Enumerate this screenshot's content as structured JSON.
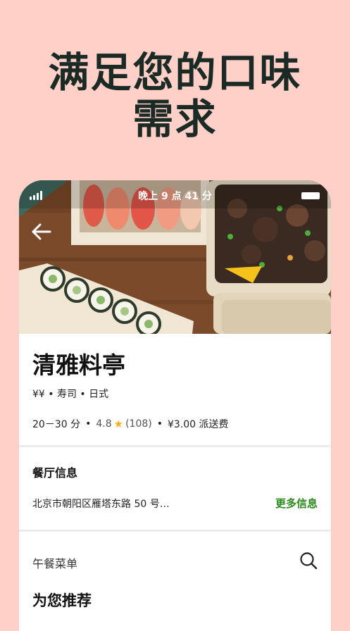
{
  "headline": {
    "line1": "满足您的口味",
    "line2": "需求"
  },
  "status_bar": {
    "time": "晚上 9 点 41 分"
  },
  "icons": {
    "back": "back-arrow-icon",
    "signal": "signal-icon",
    "battery": "battery-icon",
    "search": "search-icon",
    "star": "star-icon"
  },
  "restaurant": {
    "name": "清雅料亭",
    "tags": "¥¥ • 寿司 • 日式",
    "delivery_time": "20－30 分",
    "rating": "4.8",
    "rating_count": "(108)",
    "delivery_fee": "¥3.00 派送费"
  },
  "info_section": {
    "title": "餐厅信息",
    "address": "北京市朝阳区雁塔东路 50 号…",
    "more_label": "更多信息"
  },
  "menu_section": {
    "label": "午餐菜单",
    "recommend_title": "为您推荐"
  },
  "colors": {
    "background": "#ffd0c8",
    "headline": "#1c2a26",
    "link_green": "#2e8b1e",
    "star": "#f2b01e"
  }
}
